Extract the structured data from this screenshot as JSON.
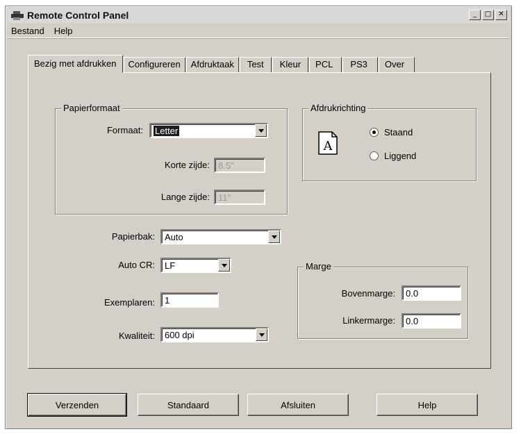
{
  "window": {
    "title": "Remote Control Panel",
    "app_icon": "printer-icon"
  },
  "window_controls": {
    "minimize": "_",
    "maximize": "□",
    "close": "✕"
  },
  "menu": [
    "Bestand",
    "Help"
  ],
  "tabs": [
    "Bezig met afdrukken",
    "Configureren",
    "Afdruktaak",
    "Test",
    "Kleur",
    "PCL",
    "PS3",
    "Over"
  ],
  "active_tab": "Bezig met afdrukken",
  "papierformaat": {
    "legend": "Papierformaat",
    "formaat_label": "Formaat:",
    "formaat_value": "Letter",
    "korte_label": "Korte zijde:",
    "korte_value": "8.5\"",
    "lange_label": "Lange zijde:",
    "lange_value": "11\""
  },
  "afdrukrichting": {
    "legend": "Afdrukrichting",
    "icon_letter": "A",
    "staand": "Staand",
    "liggend": "Liggend",
    "selected": "Staand"
  },
  "papierbak": {
    "label": "Papierbak:",
    "value": "Auto"
  },
  "autocr": {
    "label": "Auto CR:",
    "value": "LF"
  },
  "exemplaren": {
    "label": "Exemplaren:",
    "value": "1"
  },
  "kwaliteit": {
    "label": "Kwaliteit:",
    "value": "600 dpi"
  },
  "marge": {
    "legend": "Marge",
    "boven_label": "Bovenmarge:",
    "boven_value": "0.0",
    "linker_label": "Linkermarge:",
    "linker_value": "0.0"
  },
  "buttons": {
    "verzenden": "Verzenden",
    "standaard": "Standaard",
    "afsluiten": "Afsluiten",
    "help": "Help"
  }
}
